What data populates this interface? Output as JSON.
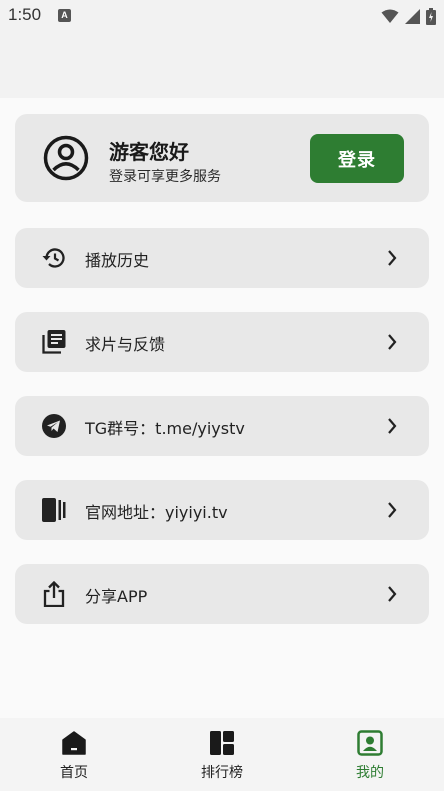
{
  "status_bar": {
    "time": "1:50",
    "app_badge": "A"
  },
  "user_card": {
    "greeting": "游客您好",
    "subtitle": "登录可享更多服务",
    "login_button": "登录"
  },
  "menu": {
    "items": [
      {
        "label": "播放历史",
        "icon": "history-icon"
      },
      {
        "label": "求片与反馈",
        "icon": "feedback-icon"
      },
      {
        "label": "TG群号：t.me/yiystv",
        "icon": "telegram-icon"
      },
      {
        "label": "官网地址：yiyiyi.tv",
        "icon": "website-icon"
      },
      {
        "label": "分享APP",
        "icon": "share-icon"
      }
    ]
  },
  "bottom_nav": {
    "items": [
      {
        "label": "首页",
        "icon": "home-icon"
      },
      {
        "label": "排行榜",
        "icon": "ranking-icon"
      },
      {
        "label": "我的",
        "icon": "profile-icon"
      }
    ],
    "active_index": 2
  },
  "colors": {
    "accent": "#2e7d32",
    "card_bg": "#e8e8e8",
    "page_bg": "#fafafa"
  }
}
